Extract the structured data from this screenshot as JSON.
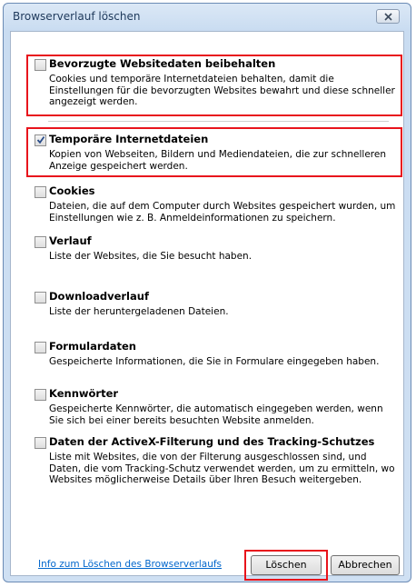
{
  "window": {
    "title": "Browserverlauf löschen"
  },
  "options": [
    {
      "title": "Bevorzugte Websitedaten beibehalten",
      "description": "Cookies und temporäre Internetdateien behalten, damit die Einstellungen für die bevorzugten Websites bewahrt und diese schneller angezeigt werden.",
      "checked": false
    },
    {
      "title": "Temporäre Internetdateien",
      "description": "Kopien von Webseiten, Bildern und Mediendateien, die zur schnelleren Anzeige gespeichert werden.",
      "checked": true
    },
    {
      "title": "Cookies",
      "description": "Dateien, die auf dem Computer durch Websites gespeichert wurden, um Einstellungen wie z. B. Anmeldeinformationen zu speichern.",
      "checked": false
    },
    {
      "title": "Verlauf",
      "description": "Liste der Websites, die Sie besucht haben.",
      "checked": false
    },
    {
      "title": "Downloadverlauf",
      "description": "Liste der heruntergeladenen Dateien.",
      "checked": false
    },
    {
      "title": "Formulardaten",
      "description": "Gespeicherte Informationen, die Sie in Formulare eingegeben haben.",
      "checked": false
    },
    {
      "title": "Kennwörter",
      "description": "Gespeicherte Kennwörter, die automatisch eingegeben werden, wenn Sie sich bei einer bereits besuchten Website anmelden.",
      "checked": false
    },
    {
      "title": "Daten der ActiveX-Filterung und des Tracking-Schutzes",
      "description": "Liste mit Websites, die von der Filterung ausgeschlossen sind, und Daten, die vom Tracking-Schutz verwendet werden, um zu ermitteln, wo Websites möglicherweise Details über Ihren Besuch weitergeben.",
      "checked": false
    }
  ],
  "footer": {
    "info_link": "Info zum Löschen des Browserverlaufs",
    "delete_label": "Löschen",
    "cancel_label": "Abbrechen"
  },
  "colors": {
    "highlight": "#e8141c",
    "link": "#0066cc"
  }
}
